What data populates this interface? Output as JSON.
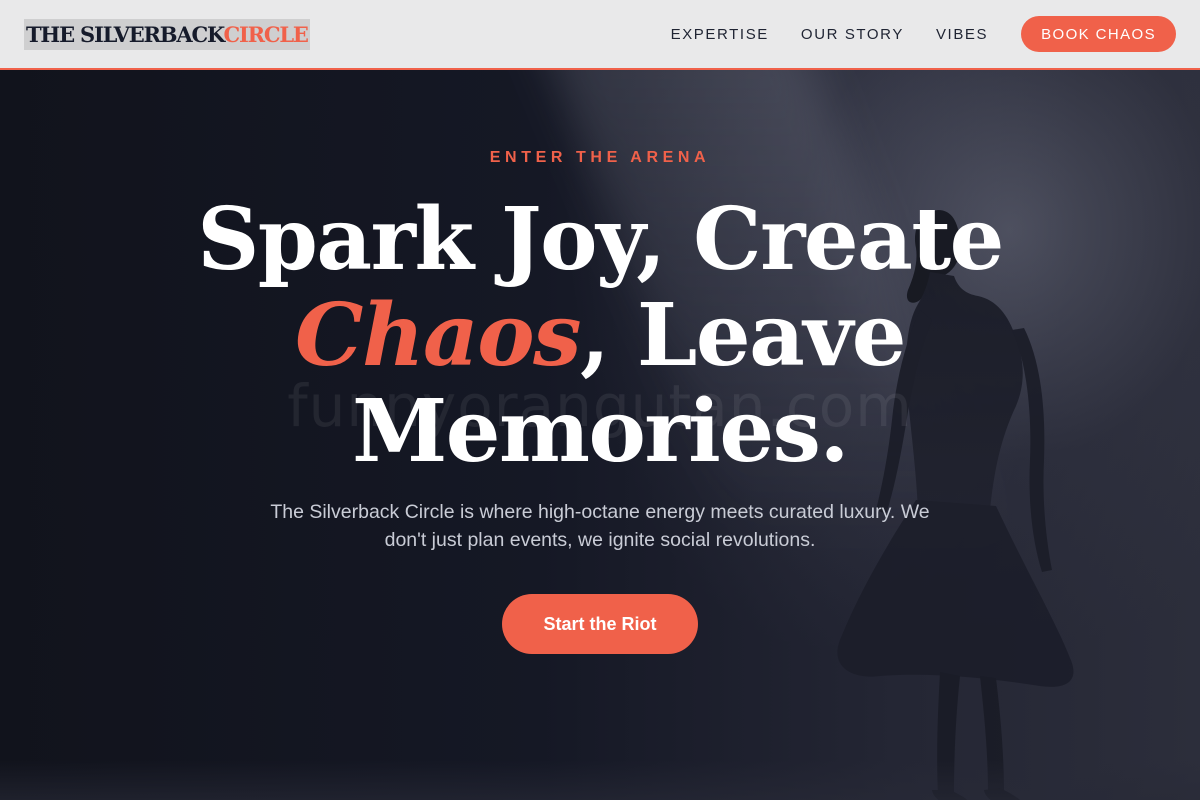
{
  "brand": {
    "name_main": "THE SILVERBACK",
    "name_accent": "CIRCLE"
  },
  "nav": {
    "items": [
      {
        "label": "EXPERTISE"
      },
      {
        "label": "OUR STORY"
      },
      {
        "label": "VIBES"
      }
    ],
    "cta_label": "BOOK CHAOS"
  },
  "hero": {
    "eyebrow": "ENTER THE ARENA",
    "headline": {
      "line1": "Spark Joy, Create",
      "emphasis": "Chaos",
      "line2_rest": ", Leave",
      "line3": "Memories."
    },
    "description": "The Silverback Circle is where high-octane energy meets curated luxury. We don't just plan events, we ignite social revolutions.",
    "cta_label": "Start the Riot",
    "watermark": "funnyorangutan.com"
  },
  "colors": {
    "accent": "#f0614a",
    "background": "#13151f",
    "header_bg": "#e9e9ea",
    "nav_text": "#1f2433"
  }
}
